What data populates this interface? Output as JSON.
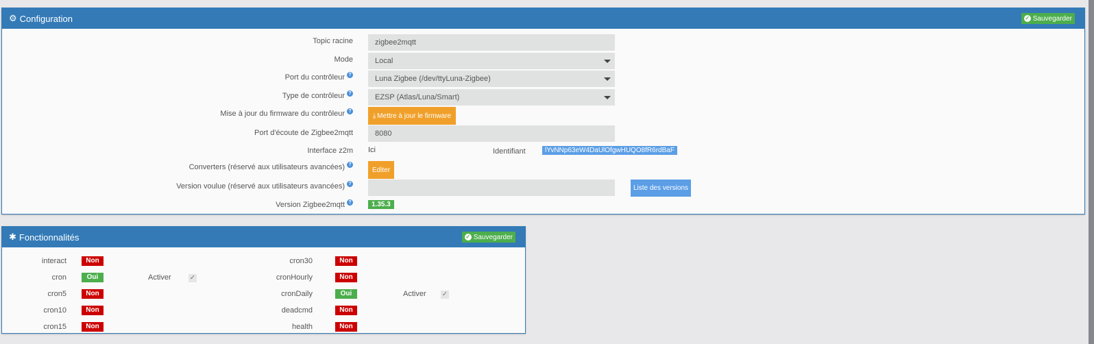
{
  "config": {
    "title": "Configuration",
    "save_label": "Sauvegarder",
    "fields": {
      "topic_label": "Topic racine",
      "topic_value": "zigbee2mqtt",
      "mode_label": "Mode",
      "mode_value": "Local",
      "port_label": "Port du contrôleur",
      "port_value": "Luna Zigbee (/dev/ttyLuna-Zigbee)",
      "type_label": "Type de contrôleur",
      "type_value": "EZSP (Atlas/Luna/Smart)",
      "fw_label": "Mise à jour du firmware du contrôleur",
      "fw_button": "Mettre à jour le firmware",
      "listen_label": "Port d'écoute de Zigbee2mqtt",
      "listen_value": "8080",
      "z2m_label": "Interface z2m",
      "z2m_link": "Ici",
      "id_label": "Identifiant",
      "id_value": "lYvNNp63eW4DaUlOfgwHUQO8fR6rdBaF",
      "conv_label": "Converters (réservé aux utilisateurs avancées)",
      "conv_button": "Editer",
      "ver_label": "Version voulue (réservé aux utilisateurs avancées)",
      "ver_value": "",
      "ver_button": "Liste des versions",
      "zver_label": "Version Zigbee2mqtt",
      "zver_value": "1.35.3"
    }
  },
  "func": {
    "title": "Fonctionnalités",
    "save_label": "Sauvegarder",
    "activer": "Activer",
    "left": [
      {
        "name": "interact",
        "state": "Non"
      },
      {
        "name": "cron",
        "state": "Oui"
      },
      {
        "name": "cron5",
        "state": "Non"
      },
      {
        "name": "cron10",
        "state": "Non"
      },
      {
        "name": "cron15",
        "state": "Non"
      }
    ],
    "right": [
      {
        "name": "cron30",
        "state": "Non"
      },
      {
        "name": "cronHourly",
        "state": "Non"
      },
      {
        "name": "cronDaily",
        "state": "Oui"
      },
      {
        "name": "deadcmd",
        "state": "Non"
      },
      {
        "name": "health",
        "state": "Non"
      }
    ]
  },
  "colors": {
    "header": "#337ab7",
    "oui": "#4cae4c",
    "non": "#cc0000",
    "orange": "#f0a02a"
  }
}
